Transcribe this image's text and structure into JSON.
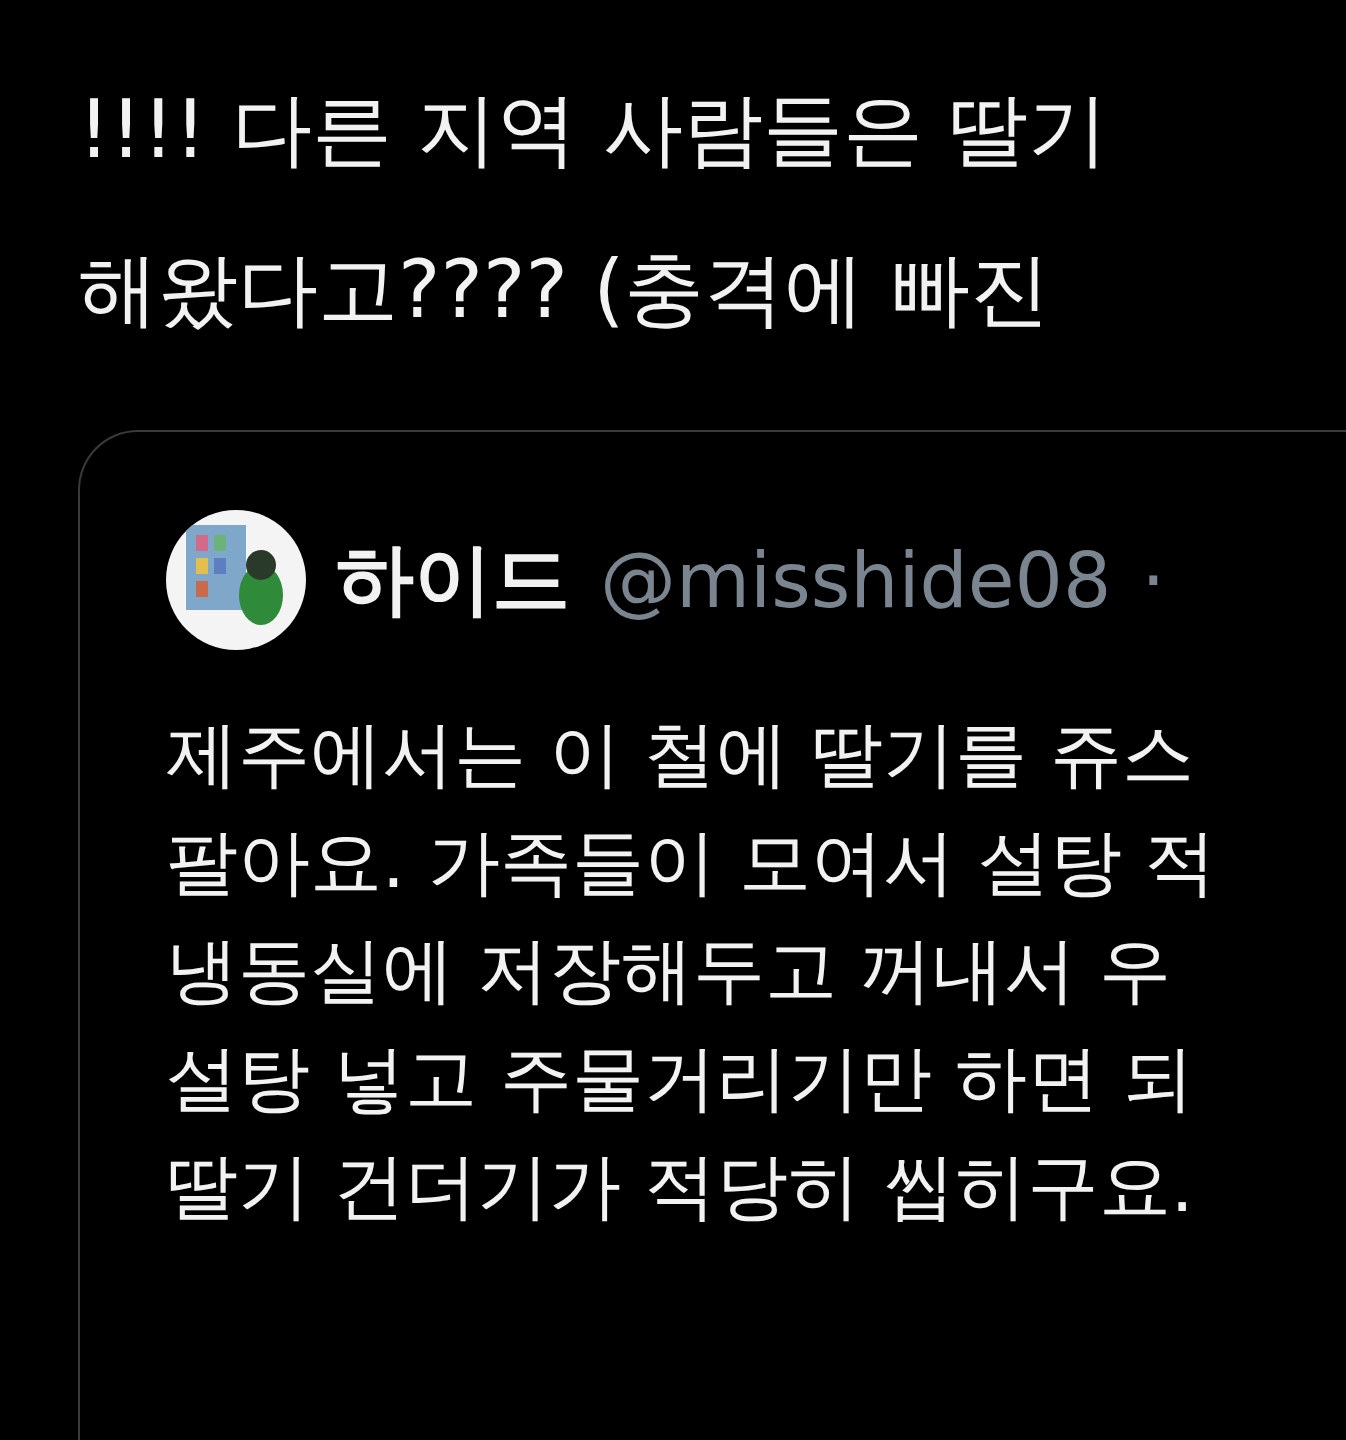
{
  "tweet": {
    "text_lines": [
      "!!!! 다른 지역 사람들은 딸기",
      "해왔다고???? (충격에 빠진"
    ]
  },
  "quoted_tweet": {
    "author_name": "하이드",
    "handle": "@misshide08",
    "separator": "·",
    "text_lines": [
      "제주에서는 이 철에 딸기를 쥬스",
      "팔아요. 가족들이 모여서 설탕 적",
      "냉동실에 저장해두고 꺼내서 우",
      "설탕 넣고 주물거리기만 하면 되",
      "딸기 건더기가 적당히 씹히구요."
    ]
  }
}
